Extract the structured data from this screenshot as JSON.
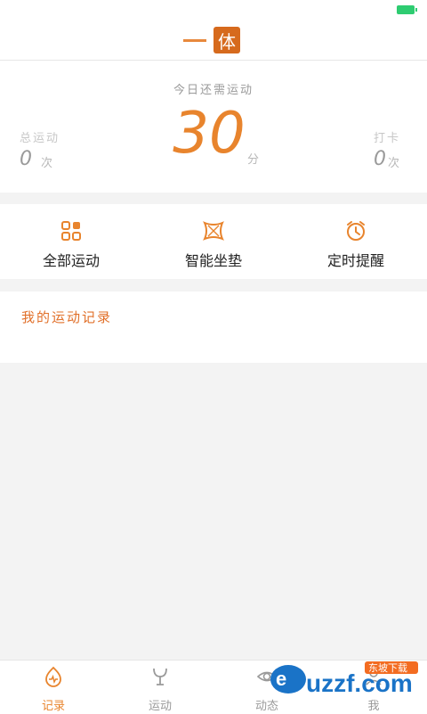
{
  "header": {
    "logo_char": "体"
  },
  "summary": {
    "need_label": "今日还需运动",
    "minutes_value": "30",
    "minutes_unit": "分",
    "total_title": "总运动",
    "total_value": "0",
    "total_unit": "次",
    "checkin_title": "打卡",
    "checkin_value": "0",
    "checkin_unit": "次"
  },
  "features": [
    {
      "label": "全部运动",
      "icon": "grid-icon"
    },
    {
      "label": "智能坐垫",
      "icon": "cushion-icon"
    },
    {
      "label": "定时提醒",
      "icon": "alarm-clock-icon"
    }
  ],
  "my_record": {
    "title": "我的运动记录"
  },
  "bottom_nav": [
    {
      "label": "记录",
      "active": true,
      "icon": "record-icon"
    },
    {
      "label": "运动",
      "active": false,
      "icon": "exercise-icon"
    },
    {
      "label": "动态",
      "active": false,
      "icon": "eye-icon"
    },
    {
      "label": "我",
      "active": false,
      "icon": "person-icon"
    }
  ],
  "watermark": {
    "top_text": "东坡下载",
    "main_text": "uzzf.com"
  },
  "colors": {
    "accent": "#e8842d",
    "accent_dark": "#d66a1d",
    "inactive": "#9a9a9a",
    "battery": "#2ecc71"
  }
}
